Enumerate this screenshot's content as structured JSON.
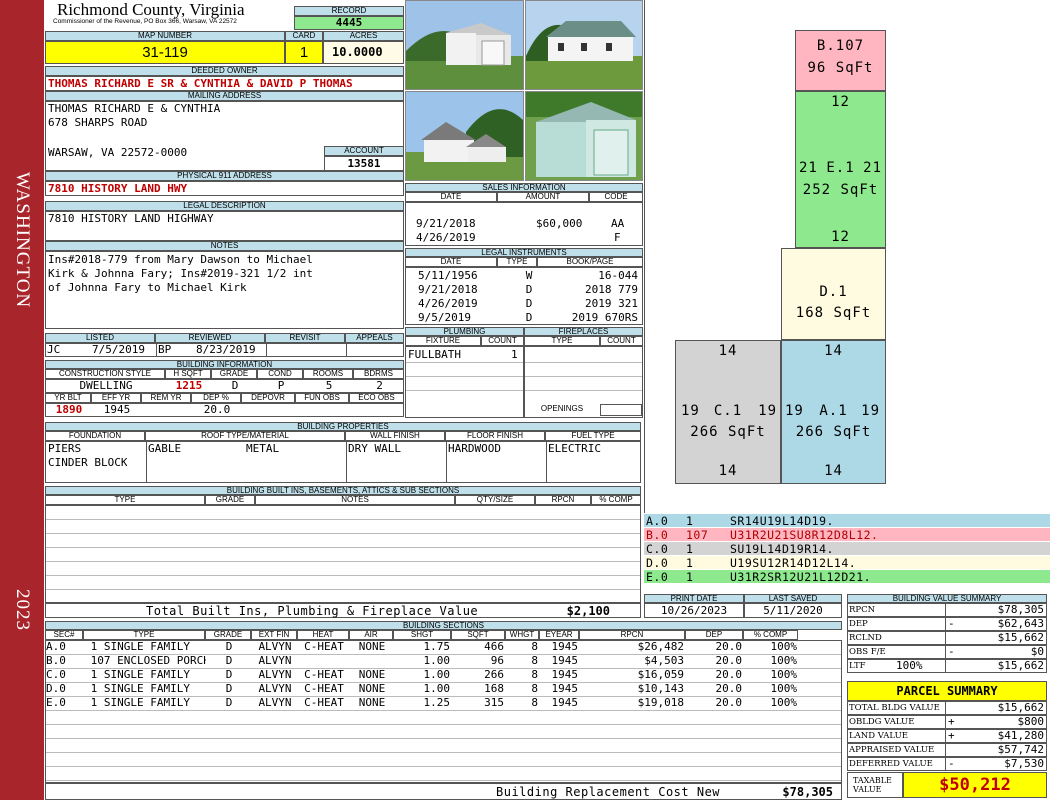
{
  "sidebar": {
    "district": "WASHINGTON",
    "year": "2023"
  },
  "header": {
    "county": "Richmond County, Virginia",
    "commissioner": "Commissioner of the Revenue, PO Box 366, Warsaw, VA 22572",
    "record_label": "RECORD",
    "record": "4445",
    "map_label": "MAP NUMBER",
    "map": "31-119",
    "card_label": "CARD",
    "card": "1",
    "acres_label": "ACRES",
    "acres": "10.0000"
  },
  "owner": {
    "label": "DEEDED OWNER",
    "name": "THOMAS RICHARD E SR & CYNTHIA & DAVID P THOMAS",
    "mail_label": "MAILING ADDRESS",
    "mail1": "THOMAS RICHARD E & CYNTHIA",
    "mail2": "678 SHARPS ROAD",
    "mail3": "WARSAW, VA 22572-0000",
    "account_label": "ACCOUNT",
    "account": "13581"
  },
  "address": {
    "label": "PHYSICAL 911 ADDRESS",
    "value": "7810 HISTORY LAND HWY"
  },
  "legal": {
    "label": "LEGAL DESCRIPTION",
    "value": "7810 HISTORY LAND HIGHWAY"
  },
  "notes": {
    "label": "NOTES",
    "lines": [
      "Ins#2018-779 from Mary Dawson to Michael",
      "Kirk & Johnna Fary; Ins#2019-321 1/2 int",
      "of Johnna Fary to Michael Kirk"
    ]
  },
  "sales": {
    "label": "SALES INFORMATION",
    "cols": [
      "DATE",
      "AMOUNT",
      "CODE"
    ],
    "rows": [
      [
        "9/21/2018",
        "$60,000",
        "AA"
      ],
      [
        "4/26/2019",
        "",
        "F"
      ]
    ]
  },
  "instruments": {
    "label": "LEGAL INSTRUMENTS",
    "cols": [
      "DATE",
      "TYPE",
      "BOOK/PAGE"
    ],
    "rows": [
      [
        "5/11/1956",
        "W",
        "16-044"
      ],
      [
        "9/21/2018",
        "D",
        "2018 779"
      ],
      [
        "4/26/2019",
        "D",
        "2019 321"
      ],
      [
        "9/5/2019",
        "D",
        "2019 670RS"
      ]
    ]
  },
  "listed": {
    "labels": [
      "LISTED",
      "REVIEWED",
      "REVISIT",
      "APPEALS"
    ],
    "listed_by": "JC",
    "listed_date": "7/5/2019",
    "reviewed_by": "BP",
    "reviewed_date": "8/23/2019"
  },
  "bldg_info": {
    "label": "BUILDING INFORMATION",
    "cols1": [
      "CONSTRUCTION STYLE",
      "H SQFT",
      "GRADE",
      "COND",
      "ROOMS",
      "BDRMS"
    ],
    "vals1": [
      "DWELLING",
      "1215",
      "D",
      "P",
      "5",
      "2"
    ],
    "cols2": [
      "YR BLT",
      "EFF YR",
      "REM YR",
      "DEP %",
      "DEPOVR",
      "FUN OBS",
      "ECO OBS"
    ],
    "vals2": [
      "1890",
      "1945",
      "",
      "20.0",
      "",
      "",
      ""
    ]
  },
  "plumbing": {
    "label": "PLUMBING",
    "cols": [
      "FIXTURE",
      "COUNT"
    ],
    "rows": [
      [
        "FULLBATH",
        "1"
      ]
    ]
  },
  "fireplaces": {
    "label": "FIREPLACES",
    "cols": [
      "TYPE",
      "COUNT"
    ],
    "openings": "OPENINGS"
  },
  "props": {
    "label": "BUILDING PROPERTIES",
    "cols": [
      "FOUNDATION",
      "ROOF TYPE/MATERIAL",
      "WALL FINISH",
      "FLOOR FINISH",
      "FUEL TYPE"
    ],
    "foundation": [
      "PIERS",
      "CINDER BLOCK"
    ],
    "roof_type": "GABLE",
    "roof_mat": "METAL",
    "wall": "DRY WALL",
    "floor": "HARDWOOD",
    "fuel": "ELECTRIC"
  },
  "builtins": {
    "label": "BUILDING BUILT INS, BASEMENTS, ATTICS & SUB SECTIONS",
    "cols": [
      "TYPE",
      "GRADE",
      "NOTES",
      "QTY/SIZE",
      "RPCN",
      "% COMP"
    ],
    "total_label": "Total Built Ins, Plumbing & Fireplace Value",
    "total": "$2,100"
  },
  "sections": {
    "label": "BUILDING SECTIONS",
    "cols": [
      "SEC#",
      "TYPE",
      "GRADE",
      "EXT FIN",
      "HEAT",
      "AIR",
      "SHGT",
      "SQFT",
      "WHGT",
      "EYEAR",
      "RPCN",
      "DEP",
      "% COMP"
    ],
    "rows": [
      [
        "A.0",
        "1 SINGLE FAMILY",
        "D",
        "ALVYN",
        "C-HEAT",
        "NONE",
        "1.75",
        "466",
        "8",
        "1945",
        "$26,482",
        "20.0",
        "100%"
      ],
      [
        "B.0",
        "107 ENCLOSED PORCH",
        "D",
        "ALVYN",
        "",
        "",
        "1.00",
        "96",
        "8",
        "1945",
        "$4,503",
        "20.0",
        "100%"
      ],
      [
        "C.0",
        "1 SINGLE FAMILY",
        "D",
        "ALVYN",
        "C-HEAT",
        "NONE",
        "1.00",
        "266",
        "8",
        "1945",
        "$16,059",
        "20.0",
        "100%"
      ],
      [
        "D.0",
        "1 SINGLE FAMILY",
        "D",
        "ALVYN",
        "C-HEAT",
        "NONE",
        "1.00",
        "168",
        "8",
        "1945",
        "$10,143",
        "20.0",
        "100%"
      ],
      [
        "E.0",
        "1 SINGLE FAMILY",
        "D",
        "ALVYN",
        "C-HEAT",
        "NONE",
        "1.25",
        "315",
        "8",
        "1945",
        "$19,018",
        "20.0",
        "100%"
      ]
    ],
    "replacement_label": "Building Replacement Cost New",
    "replacement": "$78,305"
  },
  "sketch": {
    "areas": [
      {
        "id": "B.107",
        "sqft": "96 SqFt",
        "color": "#ffb6c1"
      },
      {
        "id": "E.1",
        "sqft": "252 SqFt",
        "color": "#8ee98e",
        "top": "12",
        "bottom": "12",
        "left": "21",
        "right": "21"
      },
      {
        "id": "D.1",
        "sqft": "168 SqFt",
        "color": "#fffbe0"
      },
      {
        "id": "C.1",
        "sqft": "266 SqFt",
        "color": "#d3d3d3",
        "top": "14",
        "bottom": "14",
        "left": "19",
        "right": "19"
      },
      {
        "id": "A.1",
        "sqft": "266 SqFt",
        "color": "#add8e6",
        "top": "14",
        "bottom": "14",
        "left": "19",
        "right": "19"
      }
    ]
  },
  "legend": [
    {
      "code": "A.0",
      "num": "1",
      "path": "SR14U19L14D19.",
      "color": "#add8e6"
    },
    {
      "code": "B.0",
      "num": "107",
      "path": "U31R2U21SU8R12D8L12.",
      "color": "#ffb6c1"
    },
    {
      "code": "C.0",
      "num": "1",
      "path": "SU19L14D19R14.",
      "color": "#d3d3d3"
    },
    {
      "code": "D.0",
      "num": "1",
      "path": "U19SU12R14D12L14.",
      "color": "#fffbe0"
    },
    {
      "code": "E.0",
      "num": "1",
      "path": "U31R2SR12U21L12D21.",
      "color": "#8ee98e"
    }
  ],
  "dates": {
    "print_label": "PRINT DATE",
    "print": "10/26/2023",
    "saved_label": "LAST SAVED",
    "saved": "5/11/2020"
  },
  "bvs": {
    "label": "BUILDING VALUE SUMMARY",
    "rows": [
      [
        "RPCN",
        "",
        "$78,305"
      ],
      [
        "DEP",
        "-",
        "$62,643"
      ],
      [
        "RCLND",
        "",
        "$15,662"
      ],
      [
        "OBS F/E",
        "-",
        "$0"
      ],
      [
        "LTF",
        "100%",
        "$15,662"
      ]
    ]
  },
  "parcel": {
    "label": "PARCEL SUMMARY",
    "rows": [
      [
        "TOTAL BLDG VALUE",
        "",
        "$15,662"
      ],
      [
        "OBLDG VALUE",
        "+",
        "$800"
      ],
      [
        "LAND VALUE",
        "+",
        "$41,280"
      ],
      [
        "APPRAISED VALUE",
        "",
        "$57,742"
      ],
      [
        "DEFERRED VALUE",
        "-",
        "$7,530"
      ]
    ],
    "taxable_label1": "TAXABLE",
    "taxable_label2": "VALUE",
    "taxable": "$50,212"
  }
}
